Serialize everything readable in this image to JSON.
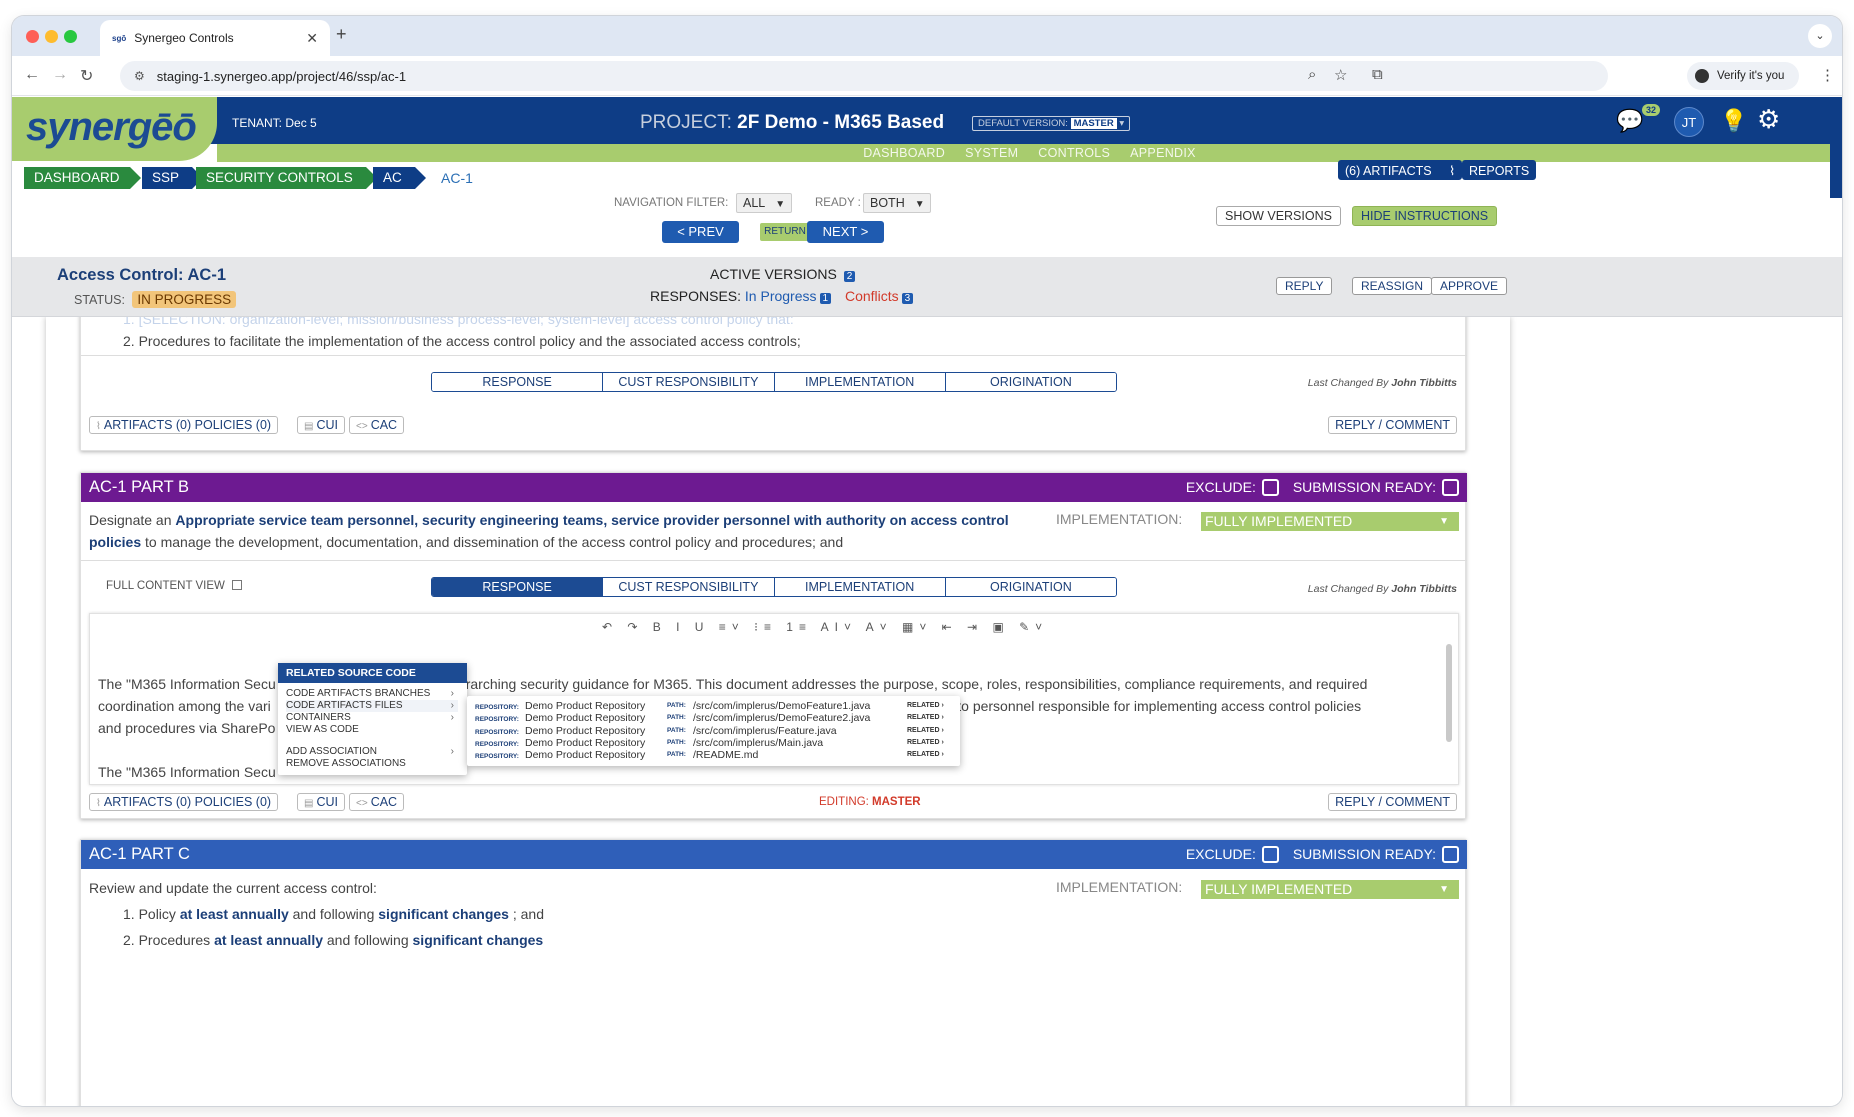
{
  "browser": {
    "tab_title": "Synergeo Controls",
    "tab_favicon_text": "sgō",
    "url": "staging-1.synergeo.app/project/46/ssp/ac-1",
    "verify_label": "Verify it's you"
  },
  "header": {
    "logo": "synergēō",
    "tenant_label": "TENANT:",
    "tenant_value": "Dec 5",
    "project_label": "PROJECT:",
    "project_name": "2F Demo - M365 Based",
    "default_version_label": "DEFAULT VERSION:",
    "default_version_value": "MASTER",
    "notifications_count": "32",
    "user_initials": "JT"
  },
  "subnav": [
    "DASHBOARD",
    "SYSTEM",
    "CONTROLS",
    "APPENDIX"
  ],
  "breadcrumbs": [
    "DASHBOARD",
    "SSP",
    "SECURITY CONTROLS",
    "AC"
  ],
  "breadcrumb_current": "AC-1",
  "top_actions": {
    "artifacts": "(6) ARTIFACTS",
    "reports": "REPORTS",
    "show_versions": "SHOW VERSIONS",
    "hide_instructions": "HIDE INSTRUCTIONS"
  },
  "filters": {
    "navigation_label": "NAVIGATION FILTER:",
    "navigation_value": "ALL",
    "ready_label": "READY :",
    "ready_value": "BOTH"
  },
  "pager": {
    "prev": "< PREV",
    "return": "RETURN",
    "next": "NEXT >"
  },
  "control": {
    "title": "Access Control: AC-1",
    "status_label": "STATUS:",
    "status_value": "IN PROGRESS",
    "active_versions_label": "ACTIVE VERSIONS",
    "active_versions_count": "2",
    "responses_label": "RESPONSES:",
    "in_progress_label": "In Progress",
    "in_progress_count": "1",
    "conflicts_label": "Conflicts",
    "conflicts_count": "3",
    "reply": "REPLY",
    "reassign": "REASSIGN",
    "approve": "APPROVE"
  },
  "part_a": {
    "faded_line": "1. [SELECTION: organization-level; mission/business process-level; system-level] access control policy that:",
    "item2": "2. Procedures to facilitate the implementation of the access control policy and the associated access controls;",
    "tabs": [
      "RESPONSE",
      "CUST RESPONSIBILITY",
      "IMPLEMENTATION",
      "ORIGINATION"
    ],
    "last_changed_label": "Last Changed By",
    "last_changed_by": "John Tibbitts",
    "artifacts_chip": "ARTIFACTS  (0)   POLICIES  (0)",
    "cui": "CUI",
    "cac": "CAC",
    "reply_comment": "REPLY / COMMENT"
  },
  "part_b": {
    "title": "AC-1 PART B",
    "exclude_label": "EXCLUDE:",
    "submission_ready_label": "SUBMISSION READY:",
    "desc_pre": "Designate an",
    "desc_bold": "Appropriate service team personnel, security engineering teams, service provider personnel with authority on access control policies",
    "desc_post": "to manage the development, documentation, and dissemination of the access control policy and procedures; and",
    "implementation_label": "IMPLEMENTATION:",
    "implementation_value": "FULLY IMPLEMENTED",
    "full_content_view": "FULL CONTENT VIEW",
    "tabs": [
      "RESPONSE",
      "CUST RESPONSIBILITY",
      "IMPLEMENTATION",
      "ORIGINATION"
    ],
    "last_changed_label": "Last Changed By",
    "last_changed_by": "John Tibbitts",
    "editor_toolbar": "↶ ↷ B I U ≡˅ ⁝≡ 1≡ AI˅ A˅ ▦˅ ⇤ ⇥ ▣ ✎˅",
    "editor_line1a": "The \"M365 Information Secu",
    "editor_line1b": "rarching security guidance for M365. This document addresses the purpose, scope, roles, responsibilities, compliance requirements, and required",
    "editor_line2a": "coordination among the vari",
    "editor_line2b": "providing some level of support for the security of M365. Policies are distributed to personnel responsible for implementing access control policies",
    "editor_line3a": "and procedures via SharePo",
    "editor_line4a": "The \"M365 Information Secu",
    "artifacts_chip": "ARTIFACTS  (0)   POLICIES  (0)",
    "cui": "CUI",
    "cac": "CAC",
    "editing_label": "EDITING:",
    "editing_value": "MASTER",
    "reply_comment": "REPLY / COMMENT"
  },
  "context_menu": {
    "header": "RELATED SOURCE CODE",
    "items": [
      "CODE ARTIFACTS BRANCHES",
      "CODE ARTIFACTS FILES",
      "CONTAINERS",
      "VIEW AS CODE",
      "ADD ASSOCIATION",
      "REMOVE ASSOCIATIONS"
    ],
    "repo_label": "REPOSITORY:",
    "path_label": "PATH:",
    "related_label": "RELATED",
    "files": [
      {
        "repo": "Demo Product Repository",
        "path": "/src/com/implerus/DemoFeature1.java"
      },
      {
        "repo": "Demo Product Repository",
        "path": "/src/com/implerus/DemoFeature2.java"
      },
      {
        "repo": "Demo Product Repository",
        "path": "/src/com/implerus/Feature.java"
      },
      {
        "repo": "Demo Product Repository",
        "path": "/src/com/implerus/Main.java"
      },
      {
        "repo": "Demo Product Repository",
        "path": "/README.md"
      }
    ]
  },
  "part_c": {
    "title": "AC-1 PART C",
    "exclude_label": "EXCLUDE:",
    "submission_ready_label": "SUBMISSION READY:",
    "intro": "Review and update the current access control:",
    "item1_pre": "1. Policy",
    "item1_b1": "at least annually",
    "item1_mid": "and following",
    "item1_b2": "significant changes",
    "item1_post": "; and",
    "item2_pre": "2. Procedures",
    "item2_b1": "at least annually",
    "item2_mid": "and following",
    "item2_b2": "significant changes",
    "implementation_label": "IMPLEMENTATION:",
    "implementation_value": "FULLY IMPLEMENTED"
  },
  "colors": {
    "brand_navy": "#0e3d86",
    "brand_green": "#a8cc6e",
    "part_b": "#6d1a91",
    "part_c": "#2f5fb9",
    "crumb_green": "#2a8a3e"
  }
}
